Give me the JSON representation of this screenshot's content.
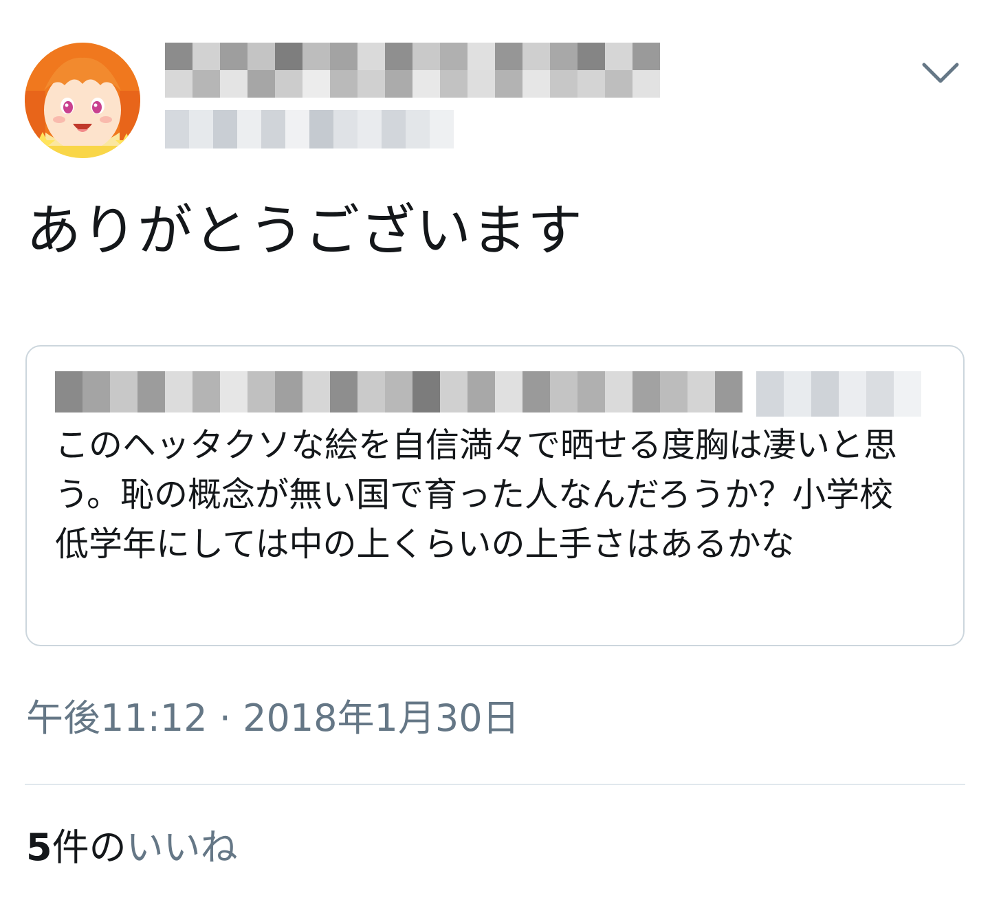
{
  "tweet": {
    "text": "ありがとうございます",
    "timestamp": "午後11:12 · 2018年1月30日"
  },
  "quoted_tweet": {
    "text": "このヘッタクソな絵を自信満々で晒せる度胸は凄いと思う。恥の概念が無い国で育った人なんだろうか？小学校低学年にしては中の上くらいの上手さはあるかな"
  },
  "likes": {
    "count": "5",
    "count_suffix": "件の",
    "label": "いいね"
  },
  "colors": {
    "text": "#14171a",
    "secondary": "#657786",
    "border": "#ccd6dd",
    "divider": "#e1e8ed",
    "avatar_hair": "#f0781e",
    "avatar_skin": "#fde3cc"
  },
  "icons": {
    "more": "chevron-down-icon"
  }
}
